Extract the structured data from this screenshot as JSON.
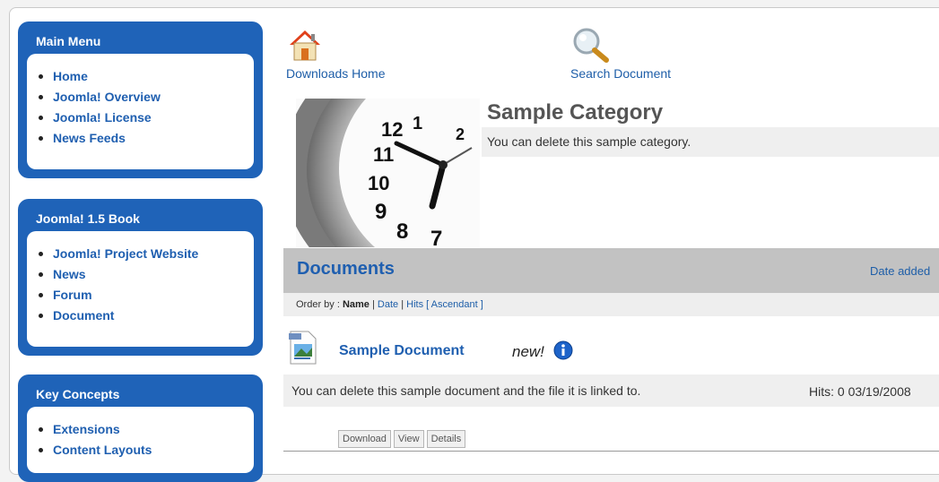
{
  "menus": [
    {
      "title": "Main Menu",
      "items": [
        "Home",
        "Joomla! Overview",
        "Joomla! License",
        "News Feeds"
      ]
    },
    {
      "title": "Joomla! 1.5 Book",
      "items": [
        "Joomla! Project Website",
        "News",
        "Forum",
        "Document"
      ]
    },
    {
      "title": "Key Concepts",
      "items": [
        "Extensions",
        "Content Layouts"
      ]
    }
  ],
  "nav": {
    "home_label": "Downloads Home",
    "home_icon": "house-icon",
    "search_label": "Search Document",
    "search_icon": "magnifier-icon"
  },
  "category": {
    "title": "Sample Category",
    "description": "You can delete this sample category."
  },
  "documents": {
    "heading": "Documents",
    "sort_link": "Date added",
    "order_label": "Order by :",
    "order_name": "Name",
    "order_sep1": "|",
    "order_date": "Date",
    "order_sep2": "|",
    "order_hits": "Hits",
    "order_dir": "[ Ascendant ]"
  },
  "document": {
    "name": "Sample Document",
    "new_badge": "new!",
    "description": "You can delete this sample document and the file it is linked to.",
    "hits": "Hits: 0",
    "date": "03/19/2008",
    "buttons": [
      "Download",
      "View",
      "Details"
    ]
  },
  "colors": {
    "accent": "#1f63b8",
    "link": "#1e5ea8",
    "bar": "#c2c2c2"
  }
}
